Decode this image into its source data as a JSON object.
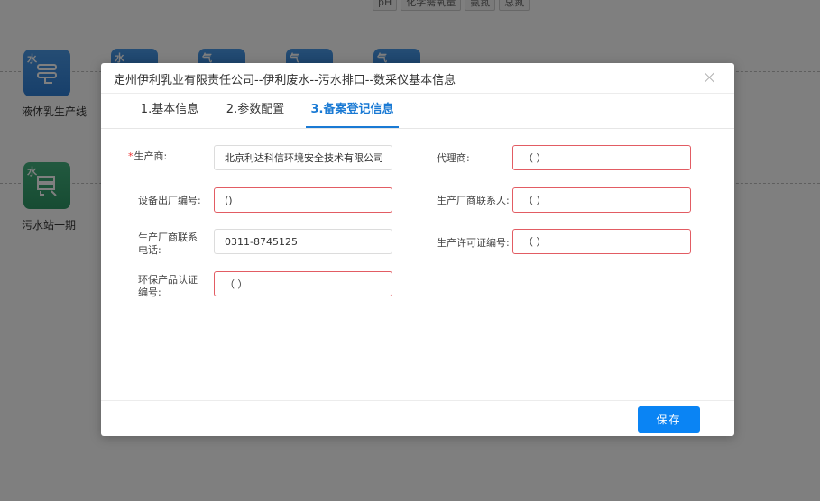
{
  "background": {
    "tags": [
      "pH",
      "化学需氧量",
      "氨氮",
      "总氮"
    ],
    "nodes": [
      {
        "badge": "水",
        "label": "液体乳生产线"
      },
      {
        "badge": "水",
        "label": "污水站一期"
      },
      {
        "badge": "水"
      },
      {
        "badge": "气"
      },
      {
        "badge": "气"
      },
      {
        "badge": "气"
      }
    ]
  },
  "modal": {
    "title": "定州伊利乳业有限责任公司--伊利废水--污水排口--数采仪基本信息",
    "tabs": [
      {
        "label": "1.基本信息",
        "active": false
      },
      {
        "label": "2.参数配置",
        "active": false
      },
      {
        "label": "3.备案登记信息",
        "active": true
      }
    ],
    "fields": {
      "manufacturer": {
        "label": "生产商:",
        "required": true,
        "value": "北京利达科信环境安全技术有限公司"
      },
      "agent": {
        "label": "代理商:",
        "value": "（ ）"
      },
      "device_factory_no": {
        "label": "设备出厂编号:",
        "value": "()"
      },
      "manufacturer_contact": {
        "label": "生产厂商联系人:",
        "value": "（ ）"
      },
      "manufacturer_phone": {
        "label": "生产厂商联系电话:",
        "value": "0311-8745125"
      },
      "license_no": {
        "label": "生产许可证编号:",
        "value": "（ ）"
      },
      "eco_cert_no": {
        "label": "环保产品认证编号:",
        "value": "（ ）"
      }
    },
    "footer": {
      "save_label": "保存"
    }
  },
  "colors": {
    "accent": "#1a7ad4",
    "primary_button": "#0a84f4",
    "error_border": "#e25c63"
  }
}
